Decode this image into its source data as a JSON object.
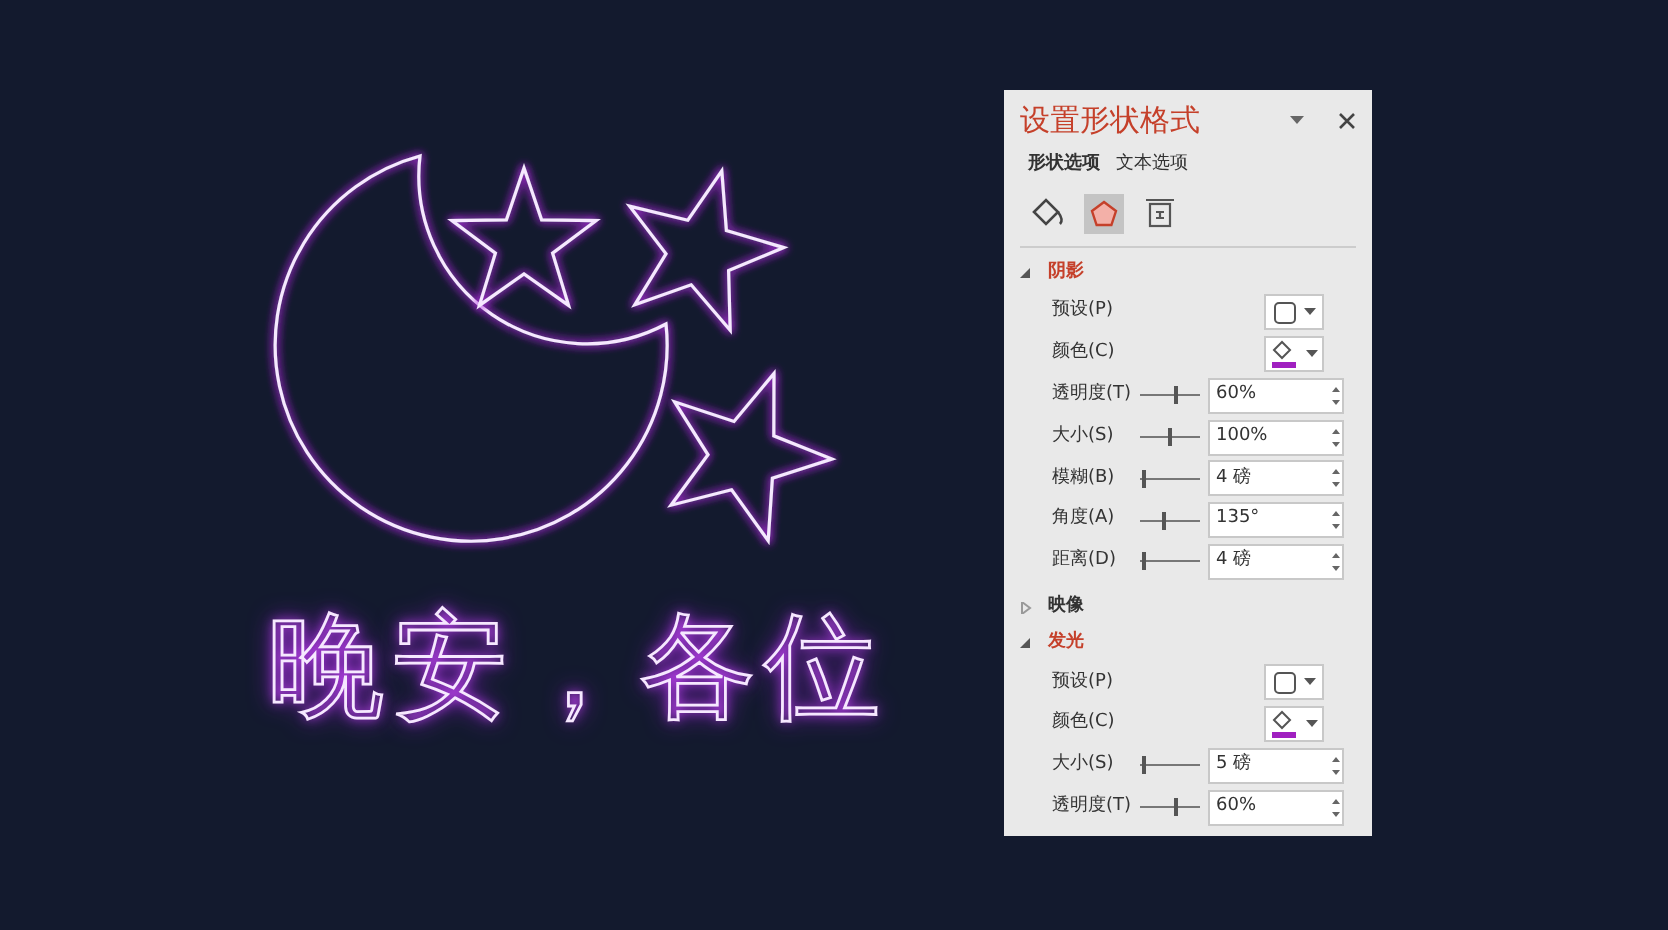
{
  "slide": {
    "headline": "晚安，各位"
  },
  "pane": {
    "title": "设置形状格式",
    "tabs": [
      {
        "label": "形状选项",
        "selected": true
      },
      {
        "label": "文本选项",
        "selected": false
      }
    ],
    "icon_tabs": [
      {
        "kind": "fill",
        "selected": false
      },
      {
        "kind": "effects",
        "selected": true
      },
      {
        "kind": "size",
        "selected": false
      }
    ],
    "sections": [
      {
        "title": "阴影",
        "expanded": true,
        "rows": [
          {
            "kind": "preset",
            "label": "预设(P)"
          },
          {
            "kind": "color",
            "label": "颜色(C)",
            "color": "#a020c0"
          },
          {
            "kind": "slider",
            "label": "透明度(T)",
            "level": 0.6,
            "value": "60%"
          },
          {
            "kind": "slider",
            "label": "大小(S)",
            "level": 0.5,
            "value": "100%"
          },
          {
            "kind": "slider",
            "label": "模糊(B)",
            "level": 0.05,
            "value": "4 磅"
          },
          {
            "kind": "slider",
            "label": "角度(A)",
            "level": 0.38,
            "value": "135°"
          },
          {
            "kind": "slider",
            "label": "距离(D)",
            "level": 0.05,
            "value": "4 磅"
          }
        ]
      },
      {
        "title": "映像",
        "expanded": false
      },
      {
        "title": "发光",
        "expanded": true,
        "rows": [
          {
            "kind": "preset",
            "label": "预设(P)"
          },
          {
            "kind": "color",
            "label": "颜色(C)",
            "color": "#a020c0"
          },
          {
            "kind": "slider",
            "label": "大小(S)",
            "level": 0.05,
            "value": "5 磅"
          },
          {
            "kind": "slider",
            "label": "透明度(T)",
            "level": 0.6,
            "value": "60%"
          }
        ]
      }
    ]
  }
}
